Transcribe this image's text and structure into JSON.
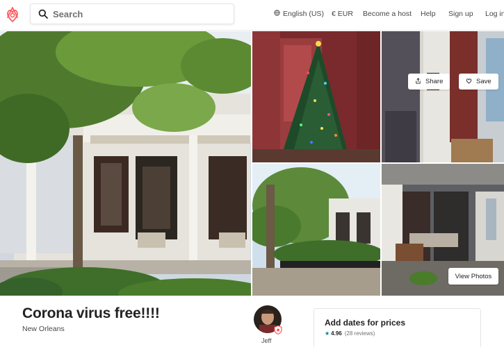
{
  "header": {
    "search_placeholder": "Search",
    "language": "English (US)",
    "currency": "€ EUR",
    "become_host": "Become a host",
    "help": "Help",
    "sign_up": "Sign up",
    "log_in": "Log in"
  },
  "gallery": {
    "share_label": "Share",
    "save_label": "Save",
    "view_photos_label": "View Photos"
  },
  "listing": {
    "title": "Corona virus free!!!!",
    "location": "New Orleans"
  },
  "host": {
    "name": "Jeff"
  },
  "booking": {
    "title": "Add dates for prices",
    "rating": "4.96",
    "reviews": "(28 reviews)"
  },
  "colors": {
    "brand": "#FF5A5F",
    "rating_accent": "#008489"
  }
}
